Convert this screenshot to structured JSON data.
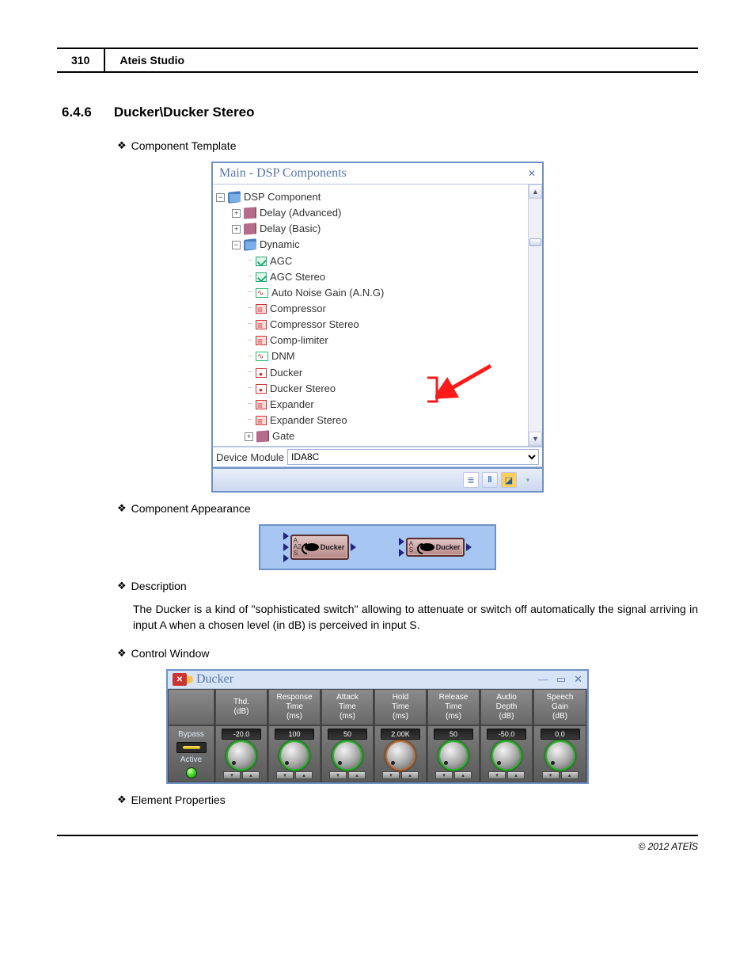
{
  "header": {
    "page_number": "310",
    "doc_title": "Ateis Studio"
  },
  "section": {
    "number": "6.4.6",
    "title": "Ducker\\Ducker Stereo"
  },
  "bullets": {
    "component_template": "Component Template",
    "component_appearance": "Component Appearance",
    "description": "Description",
    "control_window": "Control Window",
    "element_properties": "Element Properties"
  },
  "tree": {
    "title": "Main - DSP Components",
    "root": "DSP Component",
    "items": {
      "delay_adv": "Delay (Advanced)",
      "delay_basic": "Delay (Basic)",
      "dynamic": "Dynamic",
      "agc": "AGC",
      "agc_stereo": "AGC Stereo",
      "ang": "Auto Noise Gain (A.N.G)",
      "compressor": "Compressor",
      "compressor_stereo": "Compressor Stereo",
      "comp_limiter": "Comp-limiter",
      "dnm": "DNM",
      "ducker": "Ducker",
      "ducker_stereo": "Ducker Stereo",
      "expander": "Expander",
      "expander_stereo": "Expander Stereo",
      "gate": "Gate"
    },
    "device_module_label": "Device Module",
    "device_module_value": "IDA8C"
  },
  "appearance": {
    "block1_labels": [
      "A",
      "A2",
      "S"
    ],
    "block1_name": "Ducker",
    "block2_labels": [
      "A",
      "S"
    ],
    "block2_name": "Ducker"
  },
  "description_text": "The Ducker is a kind of \"sophisticated switch\" allowing to attenuate or switch off automatically the signal arriving in input A when a chosen level (in dB) is perceived in input S.",
  "control": {
    "title": "Ducker",
    "side": {
      "bypass": "Bypass",
      "active": "Active"
    },
    "cols": [
      {
        "h1": "Thd.",
        "h2": "(dB)",
        "val": "-20.0",
        "knob": "green"
      },
      {
        "h1": "Response",
        "h2": "Time",
        "h3": "(ms)",
        "val": "100",
        "knob": "green"
      },
      {
        "h1": "Attack",
        "h2": "Time",
        "h3": "(ms)",
        "val": "50",
        "knob": "green"
      },
      {
        "h1": "Hold",
        "h2": "Time",
        "h3": "(ms)",
        "val": "2.00K",
        "knob": "red"
      },
      {
        "h1": "Release",
        "h2": "Time",
        "h3": "(ms)",
        "val": "50",
        "knob": "green"
      },
      {
        "h1": "Audio",
        "h2": "Depth",
        "h3": "(dB)",
        "val": "-50.0",
        "knob": "green"
      },
      {
        "h1": "Speech",
        "h2": "Gain",
        "h3": "(dB)",
        "val": "0.0",
        "knob": "green"
      }
    ]
  },
  "footer": "© 2012 ATEÏS"
}
